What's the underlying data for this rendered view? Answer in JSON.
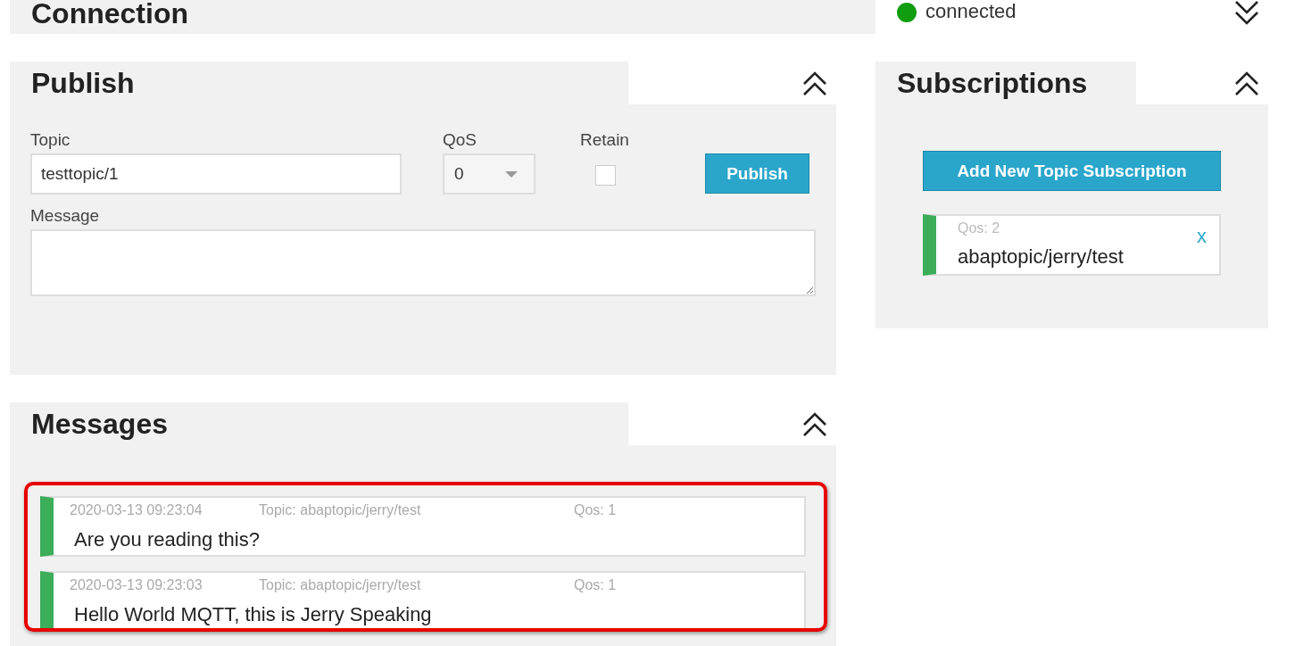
{
  "connection": {
    "title": "Connection",
    "status": "connected",
    "connected": true,
    "expanded": false
  },
  "publish": {
    "title": "Publish",
    "expanded": true,
    "topic_label": "Topic",
    "topic_value": "testtopic/1",
    "qos_label": "QoS",
    "qos_value": "0",
    "retain_label": "Retain",
    "retain_checked": false,
    "button": "Publish",
    "message_label": "Message"
  },
  "messages": {
    "title": "Messages",
    "expanded": true,
    "highlighted": true,
    "items": [
      {
        "time": "2020-03-13 09:23:04",
        "topic": "Topic: abaptopic/jerry/test",
        "qos": "Qos: 1",
        "text": "Are you reading this?",
        "color": "#3cad58"
      },
      {
        "time": "2020-03-13 09:23:03",
        "topic": "Topic: abaptopic/jerry/test",
        "qos": "Qos: 1",
        "text": "Hello World MQTT, this is Jerry Speaking",
        "color": "#3cad58"
      }
    ]
  },
  "subscriptions": {
    "title": "Subscriptions",
    "expanded": true,
    "add_button": "Add New Topic Subscription",
    "items": [
      {
        "qos": "Qos: 2",
        "topic": "abaptopic/jerry/test",
        "close": "x",
        "color": "#3cad58"
      }
    ]
  }
}
